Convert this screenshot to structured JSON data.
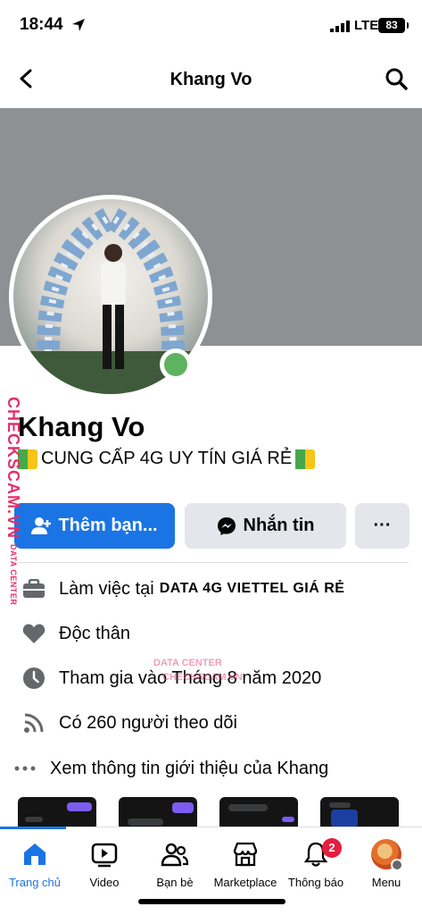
{
  "status_bar": {
    "time": "18:44",
    "network": "LTE",
    "battery": "83"
  },
  "header": {
    "title": "Khang Vo"
  },
  "profile": {
    "name": "Khang Vo",
    "bio": "CUNG CẤP 4G UY TÍN GIÁ RẺ"
  },
  "actions": {
    "add_friend": "Thêm bạn...",
    "message": "Nhắn tin",
    "more": "···"
  },
  "details": {
    "work_prefix": "Làm việc tại",
    "work_place": "DATA 4G VIETTEL GIÁ RẺ",
    "relationship": "Độc thân",
    "joined": "Tham gia vào Tháng 8 năm 2020",
    "followers": "Có 260 người theo dõi",
    "see_about": "Xem thông tin giới thiệu của Khang"
  },
  "bottom_nav": {
    "items": [
      {
        "label": "Trang chủ",
        "icon": "home-icon"
      },
      {
        "label": "Video",
        "icon": "video-icon"
      },
      {
        "label": "Bạn bè",
        "icon": "friends-icon"
      },
      {
        "label": "Marketplace",
        "icon": "marketplace-icon"
      },
      {
        "label": "Thông báo",
        "icon": "bell-icon",
        "badge": "2"
      },
      {
        "label": "Menu",
        "icon": "avatar-icon"
      }
    ]
  },
  "watermark": {
    "side": "CHECKSCAM.VN",
    "side_small": "DATA CENTER",
    "center_top": "DATA CENTER",
    "center_bottom": "CHECKSCAM.VN"
  },
  "colors": {
    "accent": "#1b74e4",
    "online": "#5fb25f",
    "badge": "#e41e3f"
  }
}
